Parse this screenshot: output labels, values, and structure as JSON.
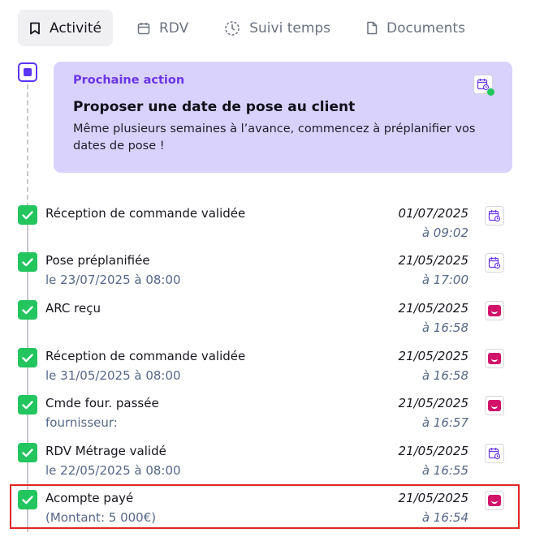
{
  "tabs": [
    {
      "label": "Activité",
      "icon": "bookmark-icon",
      "active": true
    },
    {
      "label": "RDV",
      "icon": "calendar-icon",
      "active": false
    },
    {
      "label": "Suivi temps",
      "icon": "clock-icon",
      "active": false
    },
    {
      "label": "Documents",
      "icon": "document-icon",
      "active": false
    }
  ],
  "next_action": {
    "kicker": "Prochaine action",
    "title": "Proposer une date de pose au client",
    "description": "Même plusieurs semaines à l’avance, commencez à préplanifier vos dates de pose !",
    "icon": "calendar-clock-icon",
    "status_color": "#22c55e"
  },
  "activities": [
    {
      "title": "Réception de commande validée",
      "subtitle": "",
      "date": "01/07/2025",
      "time": "à 09:02",
      "icon": "calendar-clock-icon"
    },
    {
      "title": "Pose préplanifiée",
      "subtitle": "le 23/07/2025 à 08:00",
      "date": "21/05/2025",
      "time": "à 17:00",
      "icon": "calendar-clock-icon"
    },
    {
      "title": "ARC reçu",
      "subtitle": "",
      "date": "21/05/2025",
      "time": "à 16:58",
      "icon": "brand-logo-icon"
    },
    {
      "title": "Réception de commande validée",
      "subtitle": "le 31/05/2025 à 08:00",
      "date": "21/05/2025",
      "time": "à 16:58",
      "icon": "brand-logo-icon"
    },
    {
      "title": "Cmde four. passée",
      "subtitle": "fournisseur:",
      "date": "21/05/2025",
      "time": "à 16:57",
      "icon": "brand-logo-icon"
    },
    {
      "title": "RDV Métrage validé",
      "subtitle": "le 22/05/2025 à 08:00",
      "date": "21/05/2025",
      "time": "à 16:55",
      "icon": "calendar-clock-icon"
    },
    {
      "title": "Acompte payé",
      "subtitle": "(Montant: 5 000€)",
      "date": "21/05/2025",
      "time": "à 16:54",
      "icon": "brand-logo-icon",
      "highlighted": true
    }
  ],
  "colors": {
    "accent": "#5b35f5",
    "card_bg": "#d9d2fc",
    "check": "#22c55e",
    "brand": "#d1146a",
    "highlight": "#e02424"
  }
}
